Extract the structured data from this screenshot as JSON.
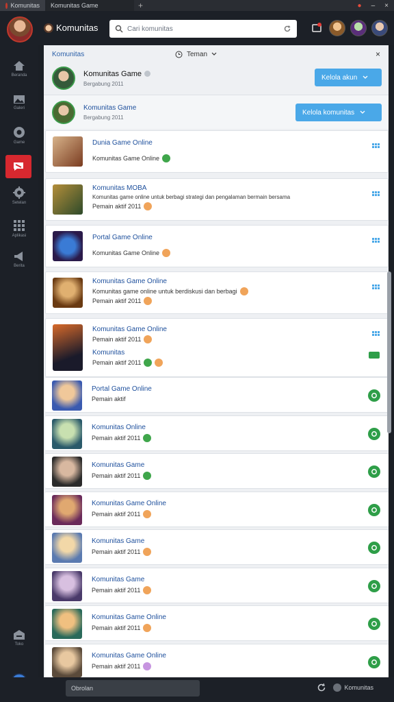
{
  "window": {
    "tab1_label": "Komunitas",
    "tab2_label": "Komunitas Game",
    "controls": [
      "●",
      "–",
      "×"
    ]
  },
  "header": {
    "brand": "Komunitas",
    "search_placeholder": "Cari komunitas"
  },
  "sidebar": {
    "items": [
      {
        "icon": "home-icon",
        "label": "Beranda"
      },
      {
        "icon": "image-icon",
        "label": "Galeri"
      },
      {
        "icon": "game-icon",
        "label": "Game"
      },
      {
        "icon": "chat-icon",
        "label": ""
      },
      {
        "icon": "settings-icon",
        "label": "Setelan"
      },
      {
        "icon": "apps-icon",
        "label": "Aplikasi"
      },
      {
        "icon": "megaphone-icon",
        "label": "Berita"
      }
    ],
    "bottom_item": {
      "icon": "store-icon",
      "label": "Toko"
    }
  },
  "panel": {
    "top_title": "Komunitas",
    "top_mid": "Teman",
    "accounts": [
      {
        "name": "Komunitas Game",
        "sub": "Bergabung 2011",
        "button": "Kelola akun"
      },
      {
        "name": "Komunitas Game",
        "sub": "Bergabung 2011",
        "button": "Kelola komunitas"
      }
    ],
    "entries": [
      {
        "title": "Dunia Game Online",
        "line1": "Komunitas Game Online",
        "line2": "",
        "status": "ok",
        "action": "menu"
      },
      {
        "title": "Komunitas MOBA",
        "line1": "Komunitas game online untuk berbagi strategi dan pengalaman bermain bersama",
        "line2": "Pemain aktif 2011",
        "status": "orange",
        "action": "menu"
      },
      {
        "title": "Portal Game Online",
        "line1": "Komunitas Game Online",
        "line2": "",
        "status": "orange",
        "action": "menu"
      },
      {
        "title": "Komunitas Game Online",
        "line1": "Komunitas game online untuk berdiskusi dan berbagi",
        "line2": "Pemain aktif 2011",
        "status": "orange",
        "action": "menu"
      },
      {
        "title": "Komunitas Game Online",
        "line1": "Pemain aktif 2011",
        "line2": "Komunitas",
        "line3": "Pemain aktif 2011",
        "status": "orange",
        "action": "menu"
      },
      {
        "title": "Portal Game Online",
        "line1": "Pemain aktif",
        "line2": "",
        "status": "",
        "action": "online"
      },
      {
        "title": "Komunitas Online",
        "line1": "Pemain aktif 2011",
        "line2": "",
        "status": "ok",
        "action": "online"
      },
      {
        "title": "Komunitas Game",
        "line1": "Pemain aktif 2011",
        "line2": "",
        "status": "ok",
        "action": "online"
      },
      {
        "title": "Komunitas Game Online",
        "line1": "Pemain aktif 2011",
        "line2": "",
        "status": "orange",
        "action": "online"
      },
      {
        "title": "Komunitas Game",
        "line1": "Pemain aktif 2011",
        "line2": "",
        "status": "orange",
        "action": "online"
      },
      {
        "title": "Komunitas Game",
        "line1": "Pemain aktif 2011",
        "line2": "",
        "status": "orange",
        "action": "online"
      },
      {
        "title": "Komunitas Game Online",
        "line1": "Pemain aktif 2011",
        "line2": "",
        "status": "orange",
        "action": "online"
      },
      {
        "title": "Komunitas Game Online",
        "line1": "Pemain aktif 2011",
        "line2": "",
        "status": "purple",
        "action": "online"
      }
    ]
  },
  "bottom": {
    "input_label": "Obrolan",
    "right_label": "Komunitas"
  }
}
